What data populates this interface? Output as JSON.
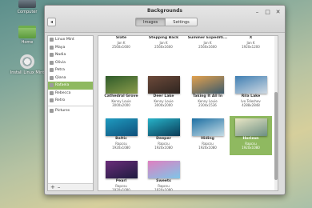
{
  "desktop": {
    "icons": [
      {
        "label": "Computer"
      },
      {
        "label": "Home"
      },
      {
        "label": "Install Linux Mint"
      }
    ]
  },
  "window": {
    "title": "Backgrounds",
    "back_glyph": "◂",
    "tabs": [
      {
        "label": "Images",
        "active": true
      },
      {
        "label": "Settings",
        "active": false
      }
    ],
    "controls": {
      "minimize": "–",
      "maximize": "□",
      "close": "✕"
    }
  },
  "sidebar": {
    "items": [
      {
        "label": "Linux Mint",
        "selected": false
      },
      {
        "label": "Maya",
        "selected": false
      },
      {
        "label": "Nadia",
        "selected": false
      },
      {
        "label": "Olivia",
        "selected": false
      },
      {
        "label": "Petra",
        "selected": false
      },
      {
        "label": "Qiana",
        "selected": false
      },
      {
        "label": "Rafaela",
        "selected": true
      },
      {
        "label": "Rebecca",
        "selected": false
      },
      {
        "label": "Retro",
        "selected": false
      },
      {
        "label": "Pictures",
        "selected": false
      }
    ],
    "add_label": "+",
    "remove_label": "–"
  },
  "grid": {
    "rows": [
      [
        {
          "name": "Slate",
          "author": "Jan K",
          "res": "2560x1600",
          "colors": [
            "#7d8a90",
            "#4d585e"
          ],
          "selected": false
        },
        {
          "name": "Stepping Back",
          "author": "Jan K",
          "res": "2560x1600",
          "colors": [
            "#8a7a65",
            "#4c4032"
          ],
          "selected": false
        },
        {
          "name": "Summer Expediti...",
          "author": "Jan K",
          "res": "2560x1600",
          "colors": [
            "#b7a35c",
            "#5a6a3a"
          ],
          "selected": false
        },
        {
          "name": "X",
          "author": "Jan K",
          "res": "1920x1200",
          "colors": [
            "#333",
            "#777"
          ],
          "selected": false
        }
      ],
      [
        {
          "name": "Cathedral Grove",
          "author": "Kenny Louie",
          "res": "3000x2000",
          "colors": [
            "#2f5b2a",
            "#8a9b4a"
          ],
          "selected": false
        },
        {
          "name": "Deer Lake",
          "author": "Kenny Louie",
          "res": "3000x2000",
          "colors": [
            "#6d4a3a",
            "#2e2520"
          ],
          "selected": false
        },
        {
          "name": "Taking It All In",
          "author": "Kenny Louie",
          "res": "2304x1536",
          "colors": [
            "#e2a14e",
            "#3b5a6c"
          ],
          "selected": false
        },
        {
          "name": "Rila Lake",
          "author": "Ivo Teleshev",
          "res": "4288x2848",
          "colors": [
            "#3f7fb3",
            "#cfd9e2"
          ],
          "selected": false
        }
      ],
      [
        {
          "name": "Baltic",
          "author": "Rapcsu",
          "res": "1920x1080",
          "colors": [
            "#1f9bc0",
            "#0e4f7a"
          ],
          "selected": false
        },
        {
          "name": "Deeper",
          "author": "Rapcsu",
          "res": "1920x1080",
          "colors": [
            "#27b3c9",
            "#0a3a56"
          ],
          "selected": false
        },
        {
          "name": "Hiding",
          "author": "Rapcsu",
          "res": "1920x1080",
          "colors": [
            "#1c6fa3",
            "#c7dde6"
          ],
          "selected": false
        },
        {
          "name": "Horizon",
          "author": "Rapcsu",
          "res": "1920x1080",
          "colors": [
            "#e9e6c5",
            "#6c8f83"
          ],
          "selected": true
        }
      ],
      [
        {
          "name": "Pearl",
          "author": "Rapcsu",
          "res": "1920x1080",
          "colors": [
            "#6a2d7a",
            "#1e1b3f"
          ],
          "selected": false
        },
        {
          "name": "Sweets",
          "author": "Rapcsu",
          "res": "1920x1080",
          "colors": [
            "#e07fc0",
            "#7ec6e8"
          ],
          "selected": false
        }
      ]
    ]
  }
}
